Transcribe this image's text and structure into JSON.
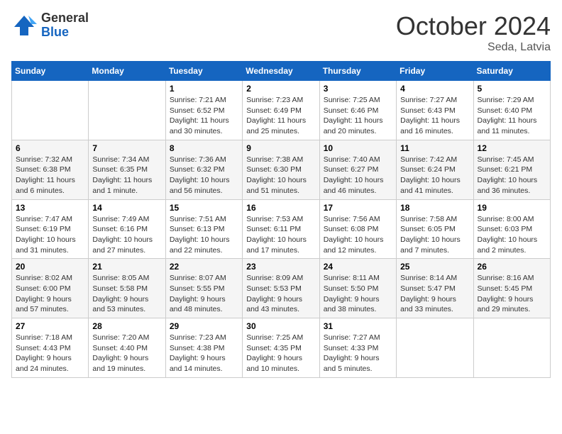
{
  "logo": {
    "general": "General",
    "blue": "Blue"
  },
  "title": "October 2024",
  "location": "Seda, Latvia",
  "days_header": [
    "Sunday",
    "Monday",
    "Tuesday",
    "Wednesday",
    "Thursday",
    "Friday",
    "Saturday"
  ],
  "weeks": [
    [
      {
        "day": "",
        "sunrise": "",
        "sunset": "",
        "daylight": ""
      },
      {
        "day": "",
        "sunrise": "",
        "sunset": "",
        "daylight": ""
      },
      {
        "day": "1",
        "sunrise": "Sunrise: 7:21 AM",
        "sunset": "Sunset: 6:52 PM",
        "daylight": "Daylight: 11 hours and 30 minutes."
      },
      {
        "day": "2",
        "sunrise": "Sunrise: 7:23 AM",
        "sunset": "Sunset: 6:49 PM",
        "daylight": "Daylight: 11 hours and 25 minutes."
      },
      {
        "day": "3",
        "sunrise": "Sunrise: 7:25 AM",
        "sunset": "Sunset: 6:46 PM",
        "daylight": "Daylight: 11 hours and 20 minutes."
      },
      {
        "day": "4",
        "sunrise": "Sunrise: 7:27 AM",
        "sunset": "Sunset: 6:43 PM",
        "daylight": "Daylight: 11 hours and 16 minutes."
      },
      {
        "day": "5",
        "sunrise": "Sunrise: 7:29 AM",
        "sunset": "Sunset: 6:40 PM",
        "daylight": "Daylight: 11 hours and 11 minutes."
      }
    ],
    [
      {
        "day": "6",
        "sunrise": "Sunrise: 7:32 AM",
        "sunset": "Sunset: 6:38 PM",
        "daylight": "Daylight: 11 hours and 6 minutes."
      },
      {
        "day": "7",
        "sunrise": "Sunrise: 7:34 AM",
        "sunset": "Sunset: 6:35 PM",
        "daylight": "Daylight: 11 hours and 1 minute."
      },
      {
        "day": "8",
        "sunrise": "Sunrise: 7:36 AM",
        "sunset": "Sunset: 6:32 PM",
        "daylight": "Daylight: 10 hours and 56 minutes."
      },
      {
        "day": "9",
        "sunrise": "Sunrise: 7:38 AM",
        "sunset": "Sunset: 6:30 PM",
        "daylight": "Daylight: 10 hours and 51 minutes."
      },
      {
        "day": "10",
        "sunrise": "Sunrise: 7:40 AM",
        "sunset": "Sunset: 6:27 PM",
        "daylight": "Daylight: 10 hours and 46 minutes."
      },
      {
        "day": "11",
        "sunrise": "Sunrise: 7:42 AM",
        "sunset": "Sunset: 6:24 PM",
        "daylight": "Daylight: 10 hours and 41 minutes."
      },
      {
        "day": "12",
        "sunrise": "Sunrise: 7:45 AM",
        "sunset": "Sunset: 6:21 PM",
        "daylight": "Daylight: 10 hours and 36 minutes."
      }
    ],
    [
      {
        "day": "13",
        "sunrise": "Sunrise: 7:47 AM",
        "sunset": "Sunset: 6:19 PM",
        "daylight": "Daylight: 10 hours and 31 minutes."
      },
      {
        "day": "14",
        "sunrise": "Sunrise: 7:49 AM",
        "sunset": "Sunset: 6:16 PM",
        "daylight": "Daylight: 10 hours and 27 minutes."
      },
      {
        "day": "15",
        "sunrise": "Sunrise: 7:51 AM",
        "sunset": "Sunset: 6:13 PM",
        "daylight": "Daylight: 10 hours and 22 minutes."
      },
      {
        "day": "16",
        "sunrise": "Sunrise: 7:53 AM",
        "sunset": "Sunset: 6:11 PM",
        "daylight": "Daylight: 10 hours and 17 minutes."
      },
      {
        "day": "17",
        "sunrise": "Sunrise: 7:56 AM",
        "sunset": "Sunset: 6:08 PM",
        "daylight": "Daylight: 10 hours and 12 minutes."
      },
      {
        "day": "18",
        "sunrise": "Sunrise: 7:58 AM",
        "sunset": "Sunset: 6:05 PM",
        "daylight": "Daylight: 10 hours and 7 minutes."
      },
      {
        "day": "19",
        "sunrise": "Sunrise: 8:00 AM",
        "sunset": "Sunset: 6:03 PM",
        "daylight": "Daylight: 10 hours and 2 minutes."
      }
    ],
    [
      {
        "day": "20",
        "sunrise": "Sunrise: 8:02 AM",
        "sunset": "Sunset: 6:00 PM",
        "daylight": "Daylight: 9 hours and 57 minutes."
      },
      {
        "day": "21",
        "sunrise": "Sunrise: 8:05 AM",
        "sunset": "Sunset: 5:58 PM",
        "daylight": "Daylight: 9 hours and 53 minutes."
      },
      {
        "day": "22",
        "sunrise": "Sunrise: 8:07 AM",
        "sunset": "Sunset: 5:55 PM",
        "daylight": "Daylight: 9 hours and 48 minutes."
      },
      {
        "day": "23",
        "sunrise": "Sunrise: 8:09 AM",
        "sunset": "Sunset: 5:53 PM",
        "daylight": "Daylight: 9 hours and 43 minutes."
      },
      {
        "day": "24",
        "sunrise": "Sunrise: 8:11 AM",
        "sunset": "Sunset: 5:50 PM",
        "daylight": "Daylight: 9 hours and 38 minutes."
      },
      {
        "day": "25",
        "sunrise": "Sunrise: 8:14 AM",
        "sunset": "Sunset: 5:47 PM",
        "daylight": "Daylight: 9 hours and 33 minutes."
      },
      {
        "day": "26",
        "sunrise": "Sunrise: 8:16 AM",
        "sunset": "Sunset: 5:45 PM",
        "daylight": "Daylight: 9 hours and 29 minutes."
      }
    ],
    [
      {
        "day": "27",
        "sunrise": "Sunrise: 7:18 AM",
        "sunset": "Sunset: 4:43 PM",
        "daylight": "Daylight: 9 hours and 24 minutes."
      },
      {
        "day": "28",
        "sunrise": "Sunrise: 7:20 AM",
        "sunset": "Sunset: 4:40 PM",
        "daylight": "Daylight: 9 hours and 19 minutes."
      },
      {
        "day": "29",
        "sunrise": "Sunrise: 7:23 AM",
        "sunset": "Sunset: 4:38 PM",
        "daylight": "Daylight: 9 hours and 14 minutes."
      },
      {
        "day": "30",
        "sunrise": "Sunrise: 7:25 AM",
        "sunset": "Sunset: 4:35 PM",
        "daylight": "Daylight: 9 hours and 10 minutes."
      },
      {
        "day": "31",
        "sunrise": "Sunrise: 7:27 AM",
        "sunset": "Sunset: 4:33 PM",
        "daylight": "Daylight: 9 hours and 5 minutes."
      },
      {
        "day": "",
        "sunrise": "",
        "sunset": "",
        "daylight": ""
      },
      {
        "day": "",
        "sunrise": "",
        "sunset": "",
        "daylight": ""
      }
    ]
  ]
}
